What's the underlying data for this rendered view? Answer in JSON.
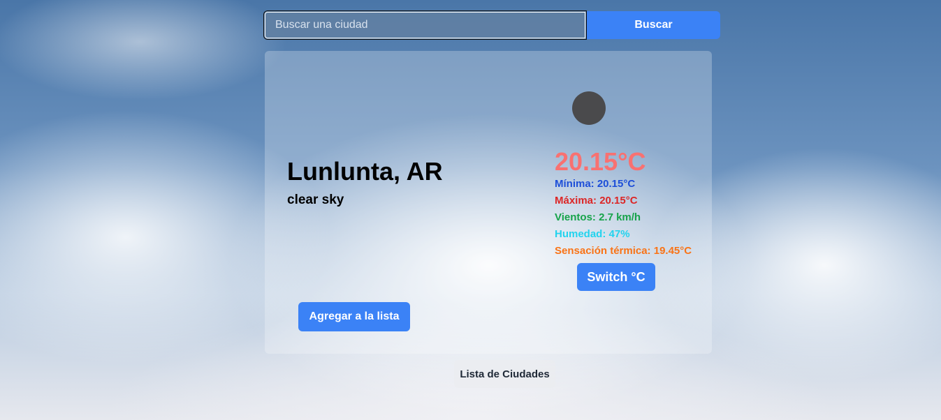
{
  "search": {
    "placeholder": "Buscar una ciudad",
    "value": "",
    "button_label": "Buscar"
  },
  "weather": {
    "city": "Lunlunta, AR",
    "description": "clear sky",
    "icon": "weather-condition-icon",
    "temperature": "20.15°C",
    "stats": {
      "min": "Mínima: 20.15°C",
      "max": "Máxima: 20.15°C",
      "wind": "Vientos: 2.7 km/h",
      "humidity": "Humedad: 47%",
      "feels_like": "Sensación térmica: 19.45°C"
    },
    "switch_label": "Switch °C",
    "add_label": "Agregar a la lista"
  },
  "city_list": {
    "label": "Lista de Ciudades"
  },
  "colors": {
    "accent": "#3b82f6",
    "temperature": "#f87171",
    "min": "#1d4ed8",
    "max": "#dc2626",
    "wind": "#16a34a",
    "humidity": "#22d3ee",
    "feels_like": "#f97316"
  }
}
